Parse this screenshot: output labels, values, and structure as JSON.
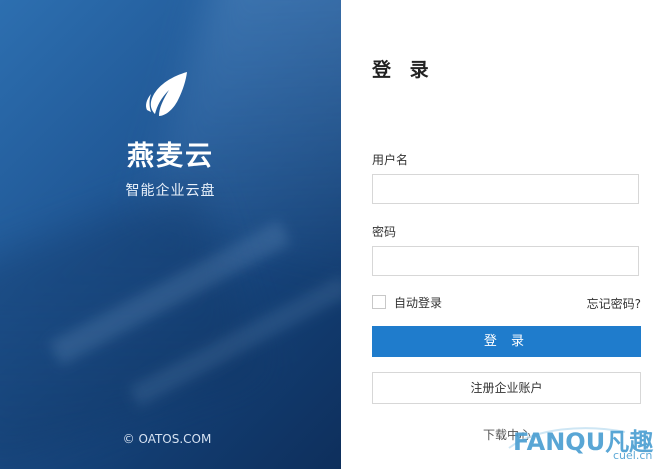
{
  "brand": {
    "name": "燕麦云",
    "slogan": "智能企业云盘",
    "copyright": "© OATOS.COM",
    "logo_icon": "leaf-icon"
  },
  "login": {
    "title": "登 录",
    "username_label": "用户名",
    "username_value": "",
    "password_label": "密码",
    "password_value": "",
    "auto_login_label": "自动登录",
    "auto_login_checked": false,
    "forgot_password": "忘记密码?",
    "login_button": "登 录",
    "register_button": "注册企业账户",
    "download_link": "下载中心"
  },
  "watermark": {
    "text": "FANQU凡趣",
    "sub": "cuel.cn"
  },
  "colors": {
    "accent": "#1f7ccc",
    "panel_dark": "#123c70",
    "panel_light": "#2d6fb0"
  }
}
